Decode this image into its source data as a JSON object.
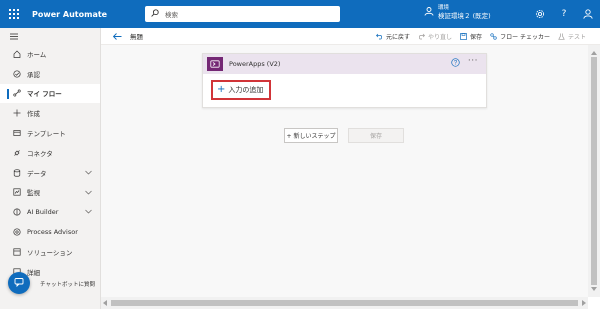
{
  "header": {
    "app_title": "Power Automate",
    "search_placeholder": "検索",
    "environment_label": "環境",
    "environment_name": "検証環境２ (既定)"
  },
  "nav": {
    "items": [
      {
        "label": "ホーム",
        "icon": "home-icon"
      },
      {
        "label": "承認",
        "icon": "approval-icon"
      },
      {
        "label": "マイ フロー",
        "icon": "my-flows-icon",
        "active": true
      },
      {
        "label": "作成",
        "icon": "plus-icon"
      },
      {
        "label": "テンプレート",
        "icon": "template-icon"
      },
      {
        "label": "コネクタ",
        "icon": "connector-icon"
      },
      {
        "label": "データ",
        "icon": "data-icon",
        "expandable": true
      },
      {
        "label": "監視",
        "icon": "monitor-icon",
        "expandable": true
      },
      {
        "label": "AI Builder",
        "icon": "ai-builder-icon",
        "expandable": true
      },
      {
        "label": "Process Advisor",
        "icon": "process-advisor-icon"
      },
      {
        "label": "ソリューション",
        "icon": "solutions-icon"
      },
      {
        "label": "詳細",
        "icon": "more-icon"
      }
    ],
    "chatbot_label": "チャットボットに質問"
  },
  "commandbar": {
    "flow_name": "無題",
    "undo": "元に戻す",
    "redo": "やり直し",
    "save": "保存",
    "flow_checker": "フロー チェッカー",
    "test": "テスト"
  },
  "canvas": {
    "card_title": "PowerApps (V2)",
    "add_input": "入力の追加",
    "new_step": "+ 新しいステップ",
    "save_button": "保存"
  },
  "colors": {
    "header_blue": "#0f6cbd",
    "powerapps_purple": "#742774",
    "highlight_red": "#d13438"
  }
}
